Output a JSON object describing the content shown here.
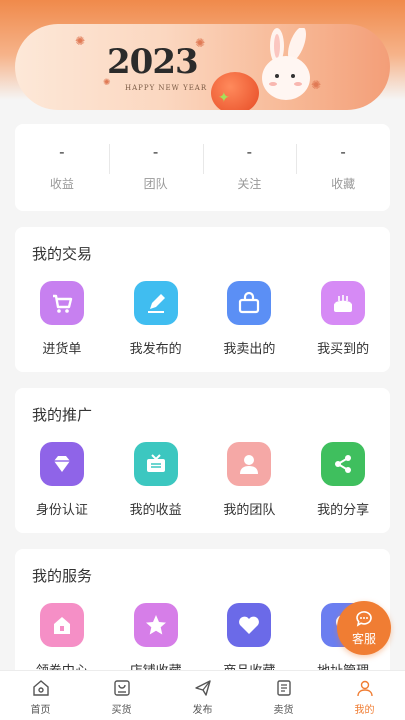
{
  "banner": {
    "year": "2023",
    "greeting": "HAPPY NEW YEAR"
  },
  "stats": [
    {
      "value": "-",
      "label": "收益"
    },
    {
      "value": "-",
      "label": "团队"
    },
    {
      "value": "-",
      "label": "关注"
    },
    {
      "value": "-",
      "label": "收藏"
    }
  ],
  "trade": {
    "title": "我的交易",
    "items": [
      {
        "label": "进货单",
        "icon": "cart-icon",
        "color": "#c780f0"
      },
      {
        "label": "我发布的",
        "icon": "pen-icon",
        "color": "#40bdf0"
      },
      {
        "label": "我卖出的",
        "icon": "basket-icon",
        "color": "#5b8ff5"
      },
      {
        "label": "我买到的",
        "icon": "cake-icon",
        "color": "#d68af5"
      }
    ]
  },
  "promo": {
    "title": "我的推广",
    "items": [
      {
        "label": "身份认证",
        "icon": "diamond-icon",
        "color": "#8f64e8"
      },
      {
        "label": "我的收益",
        "icon": "tv-icon",
        "color": "#3cc7c0"
      },
      {
        "label": "我的团队",
        "icon": "person-icon",
        "color": "#f5a8a6"
      },
      {
        "label": "我的分享",
        "icon": "share-icon",
        "color": "#3fbf5e"
      }
    ]
  },
  "service": {
    "title": "我的服务",
    "items": [
      {
        "label": "领券中心",
        "icon": "house-icon",
        "color": "#f58fc6"
      },
      {
        "label": "店铺收藏",
        "icon": "star-icon",
        "color": "#d67ee8"
      },
      {
        "label": "商品收藏",
        "icon": "heart-icon",
        "color": "#6b6ae8"
      },
      {
        "label": "地址管理",
        "icon": "location-icon",
        "color": "#6b7ef0"
      }
    ]
  },
  "fab": {
    "label": "客服",
    "icon": "chat-icon"
  },
  "tabs": [
    {
      "label": "首页",
      "icon": "home-icon"
    },
    {
      "label": "买货",
      "icon": "bag-icon"
    },
    {
      "label": "发布",
      "icon": "paper-plane-icon"
    },
    {
      "label": "卖货",
      "icon": "receipt-icon"
    },
    {
      "label": "我的",
      "icon": "user-icon",
      "active": true
    }
  ],
  "colors": {
    "accent": "#f07d33",
    "header": "#f08a4b"
  }
}
